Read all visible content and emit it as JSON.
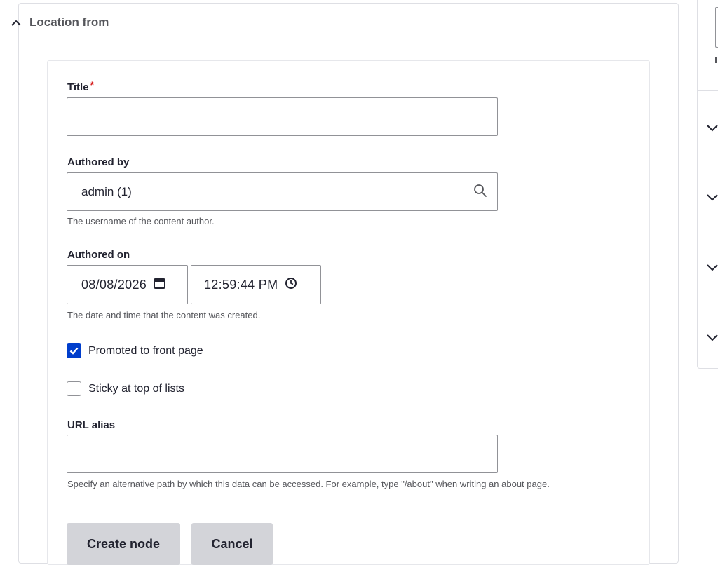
{
  "section": {
    "title": "Location from"
  },
  "form": {
    "title": {
      "label": "Title",
      "required_mark": "*",
      "value": ""
    },
    "authored_by": {
      "label": "Authored by",
      "value": "admin (1)",
      "description": "The username of the content author."
    },
    "authored_on": {
      "label": "Authored on",
      "date": "08/08/2026",
      "time": "12:59:44 PM",
      "description": "The date and time that the content was created."
    },
    "promoted": {
      "label": "Promoted to front page",
      "checked": true
    },
    "sticky": {
      "label": "Sticky at top of lists",
      "checked": false
    },
    "url_alias": {
      "label": "URL alias",
      "value": "",
      "description": "Specify an alternative path by which this data can be accessed. For example, type \"/about\" when writing an about page."
    }
  },
  "actions": {
    "create_label": "Create node",
    "cancel_label": "Cancel"
  },
  "colors": {
    "accent": "#003ecc",
    "required": "#d72222",
    "button_bg": "#d3d4d9",
    "border": "#919297"
  },
  "icons": {
    "section_toggle": "chevron-up-icon",
    "autocomplete": "search-icon",
    "date": "calendar-icon",
    "time": "clock-icon",
    "right_rail": "chevron-down-icon"
  }
}
